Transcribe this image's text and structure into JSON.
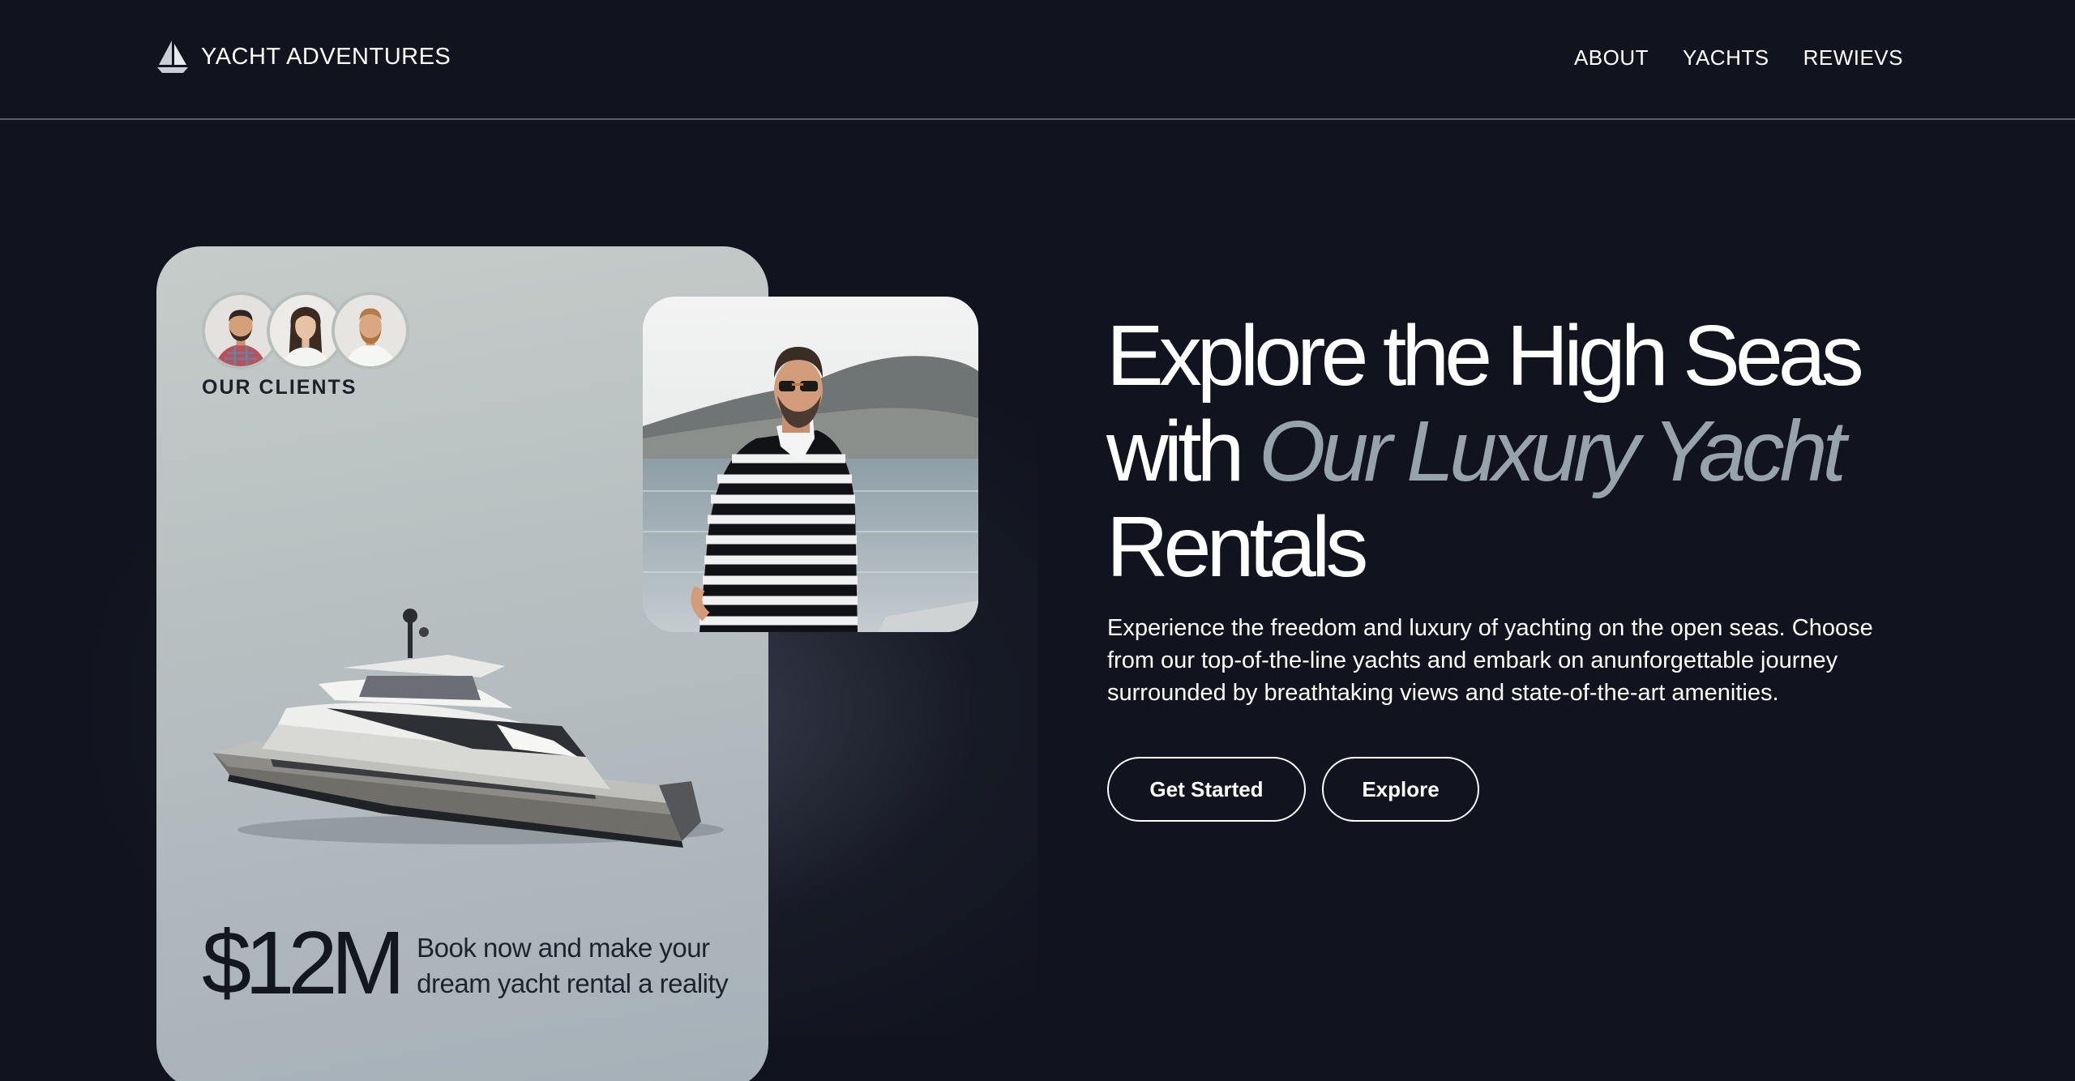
{
  "header": {
    "brand": "YACHT ADVENTURES",
    "brand_icon": "sailboat-icon",
    "nav": [
      {
        "label": "ABOUT"
      },
      {
        "label": "YACHTS"
      },
      {
        "label": "REWIEVS"
      }
    ]
  },
  "hero": {
    "headline": {
      "line1": "Explore the High Seas",
      "line2_plain": "with",
      "line2_emphasis": "Our Luxury Yacht",
      "line3": "Rentals"
    },
    "description": "Experience the freedom and luxury of yachting on the open seas. Choose from our top-of-the-line yachts and embark on anunforgettable journey surrounded by breathtaking views and state-of-the-art amenities.",
    "buttons": {
      "primary": "Get Started",
      "secondary": "Explore"
    }
  },
  "card": {
    "clients_label": "OUR CLIENTS",
    "price": "$12M",
    "price_caption": "Book now and make your dream yacht rental a reality"
  },
  "colors": {
    "background": "#11141f",
    "accent_text": "#96a2ac",
    "card_background": "#b9c1c2",
    "text_primary": "#ffffff"
  }
}
